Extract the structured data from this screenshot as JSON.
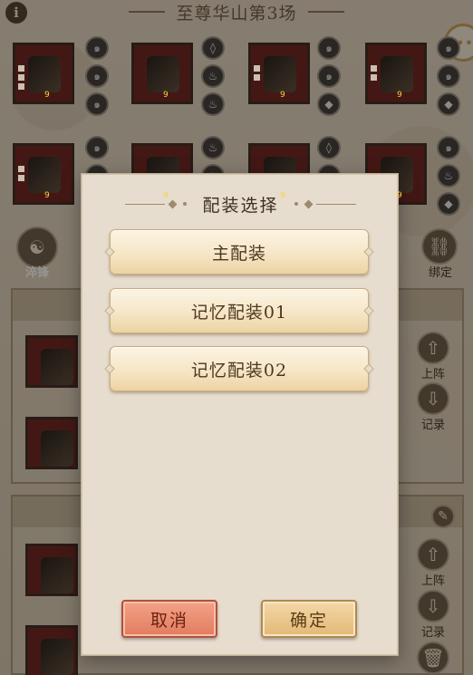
{
  "header": {
    "title": "至尊华山第3场",
    "info_icon": "info-icon",
    "chat_icon": "chat-bubble-icon"
  },
  "equipment": {
    "slots": [
      {
        "item": "dagger-icon",
        "level": "9",
        "gems": [
          "swirl-gem-icon",
          "swirl-gem-icon",
          "swirl-gem-icon"
        ]
      },
      {
        "item": "robe-icon",
        "level": "9",
        "gems": [
          "shield-gem-icon",
          "fire-gem-icon",
          "fire-gem-icon"
        ]
      },
      {
        "item": "belt-icon",
        "level": "9",
        "gems": [
          "swirl-gem-icon",
          "swirl-gem-icon",
          "water-gem-icon"
        ]
      },
      {
        "item": "boots-icon",
        "level": "9",
        "gems": [
          "swirl-gem-icon",
          "swirl-gem-icon",
          "water-gem-icon"
        ]
      },
      {
        "item": "necklace-icon",
        "level": "9",
        "gems": [
          "swirl-gem-icon",
          "swirl-gem-icon",
          "swirl-gem-icon"
        ]
      },
      {
        "item": "ring-icon",
        "level": "9",
        "gems": [
          "fire-gem-icon",
          "fire-gem-icon",
          "fire-gem-icon"
        ]
      },
      {
        "item": "bracelet-icon",
        "level": "9",
        "gems": [
          "shield-gem-icon",
          "swirl-gem-icon",
          "swirl-gem-icon"
        ]
      },
      {
        "item": "jade-pendant-icon",
        "level": "9",
        "gems": [
          "swirl-gem-icon",
          "fire-gem-icon",
          "water-gem-icon"
        ]
      }
    ]
  },
  "side": {
    "left_label": "淬锋",
    "bind_label": "绑定",
    "panels": [
      {
        "deploy_label": "上阵",
        "record_label": "记录"
      },
      {
        "deploy_label": "上阵",
        "record_label": "记录"
      }
    ]
  },
  "modal": {
    "title": "配装选择",
    "options": [
      {
        "label": "主配装"
      },
      {
        "label": "记忆配装01"
      },
      {
        "label": "记忆配装02"
      }
    ],
    "cancel_label": "取消",
    "confirm_label": "确定"
  }
}
